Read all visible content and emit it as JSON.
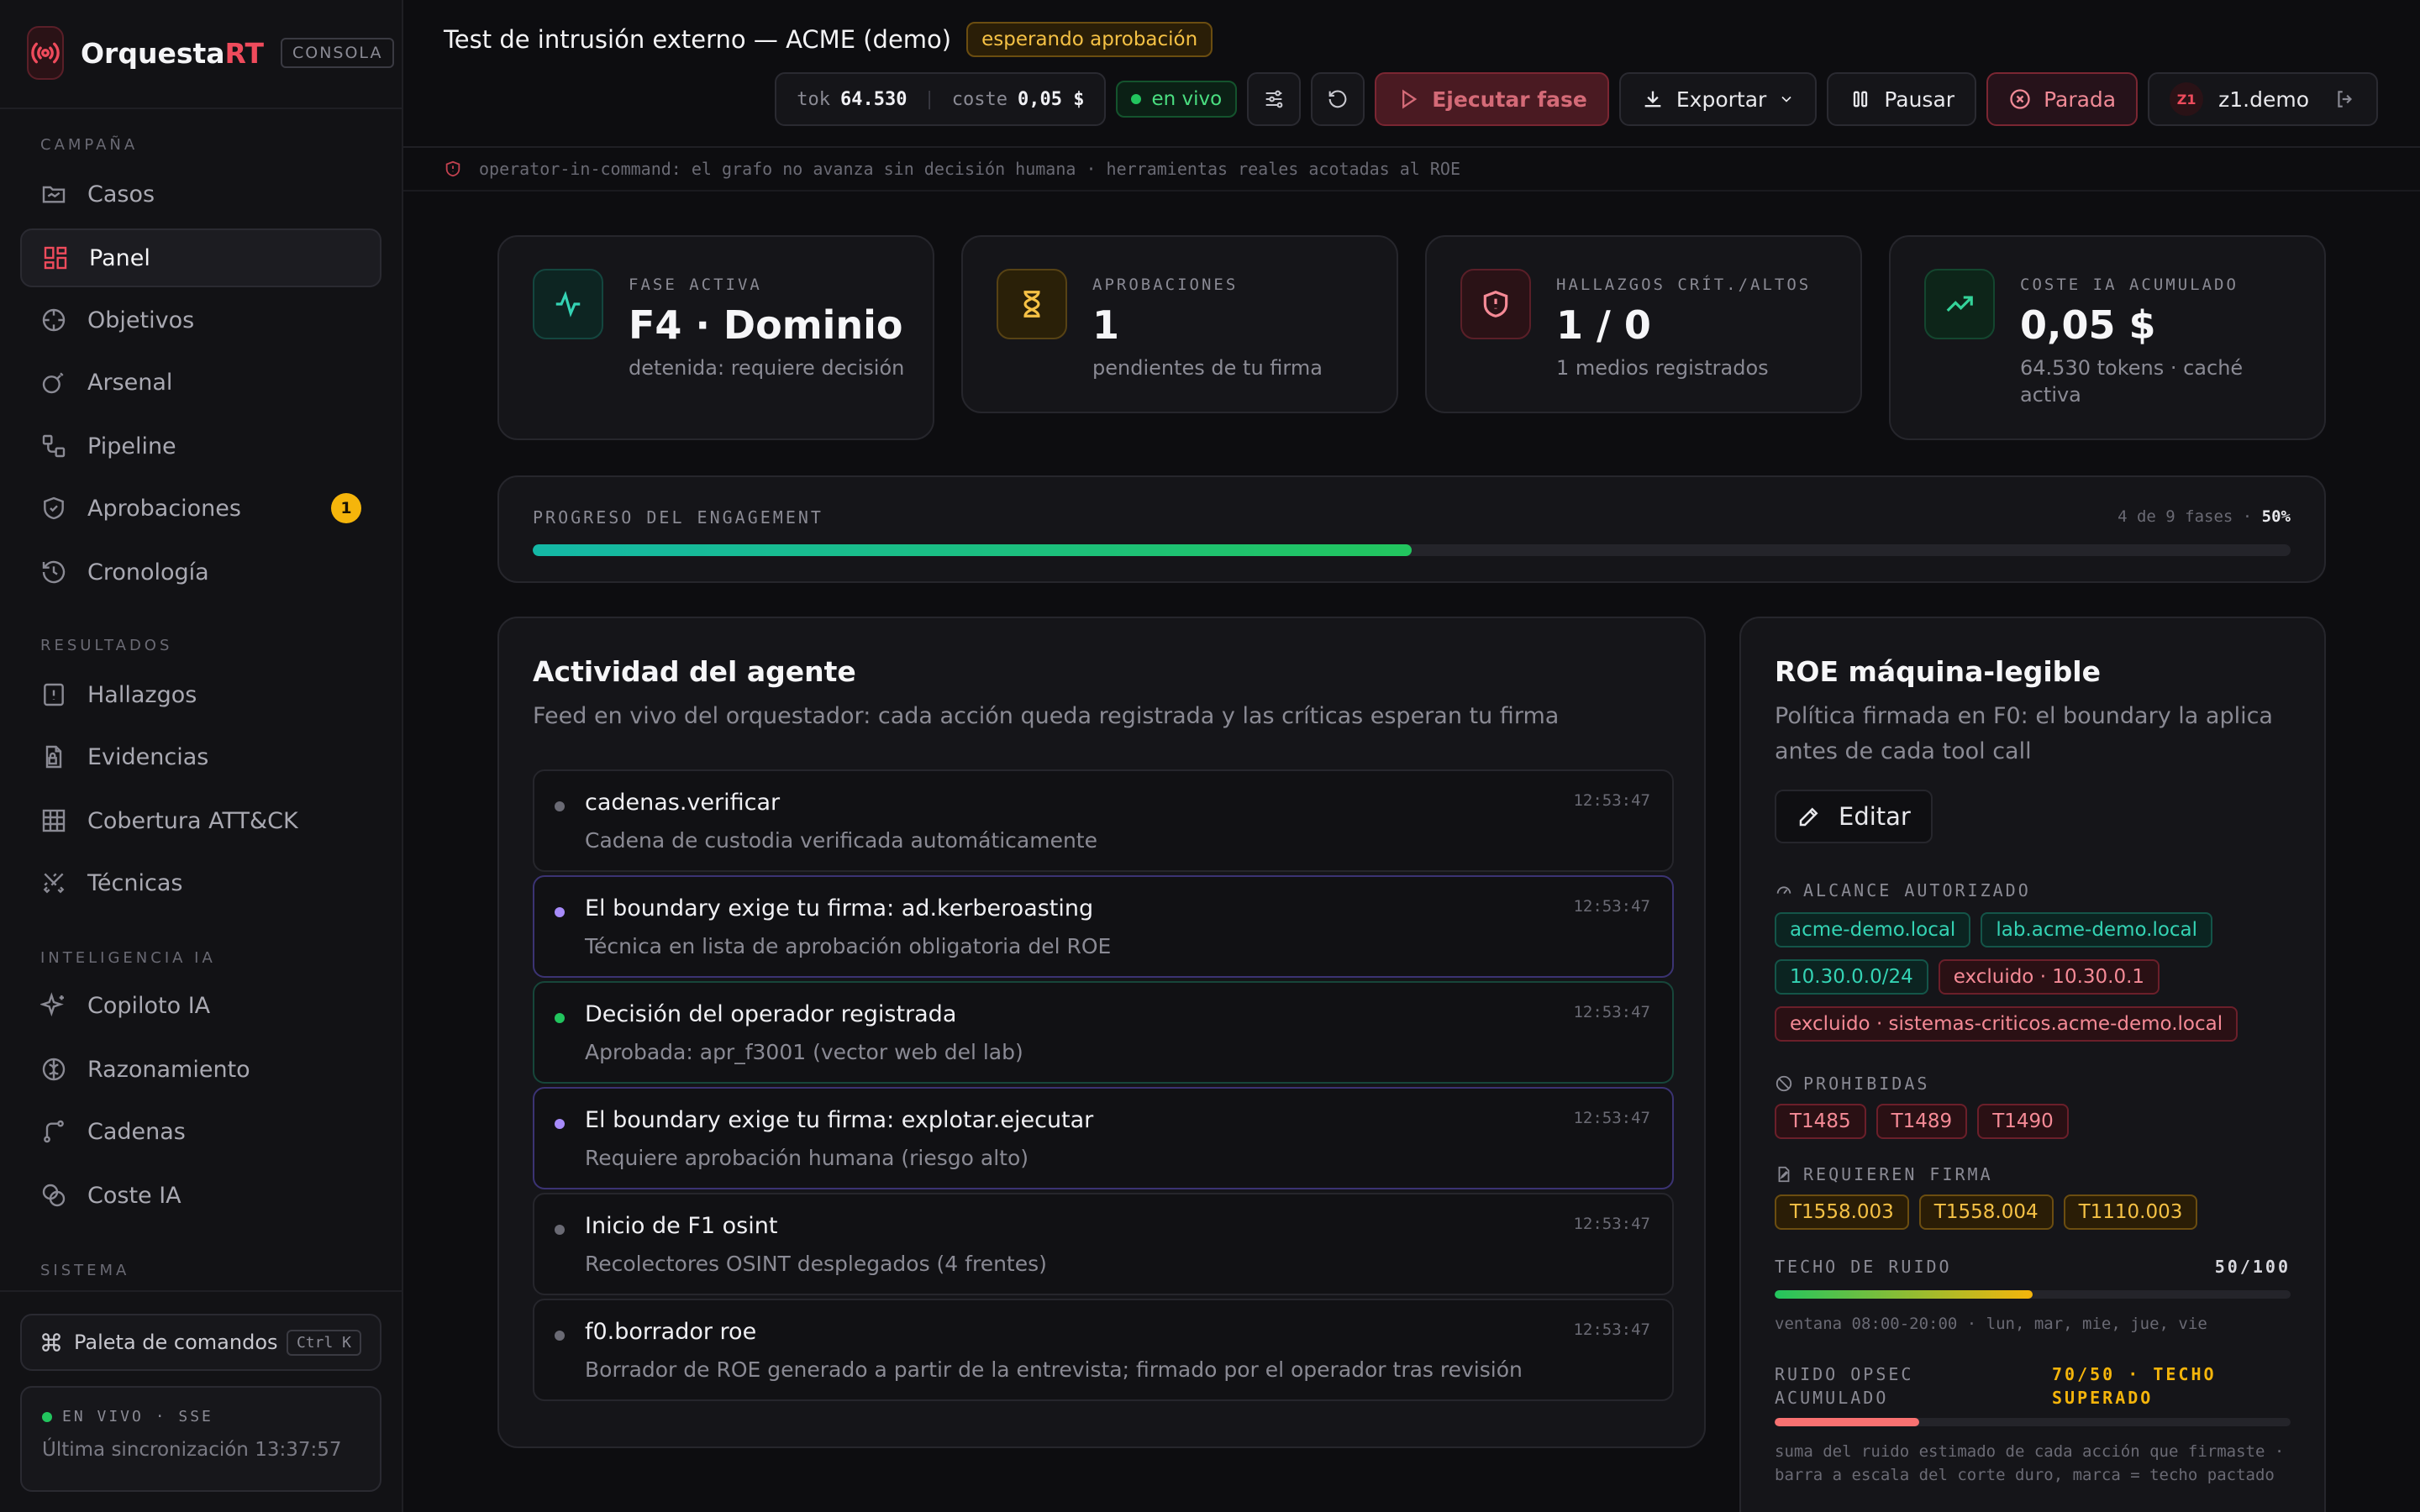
{
  "brand": {
    "name_main": "Orquesta",
    "name_accent": "RT",
    "tag": "CONSOLA"
  },
  "sidebar": {
    "sections": {
      "campaign": "CAMPAÑA",
      "results": "RESULTADOS",
      "ai": "INTELIGENCIA IA",
      "system": "SISTEMA"
    },
    "items": [
      {
        "label": "Casos",
        "icon": "folder-icon"
      },
      {
        "label": "Panel",
        "icon": "dashboard-icon",
        "active": true
      },
      {
        "label": "Objetivos",
        "icon": "crosshair-icon"
      },
      {
        "label": "Arsenal",
        "icon": "bomb-icon"
      },
      {
        "label": "Pipeline",
        "icon": "workflow-icon"
      },
      {
        "label": "Aprobaciones",
        "icon": "shield-check-icon",
        "badge": "1"
      },
      {
        "label": "Cronología",
        "icon": "history-icon"
      },
      {
        "label": "Hallazgos",
        "icon": "file-alert-icon"
      },
      {
        "label": "Evidencias",
        "icon": "file-lock-icon"
      },
      {
        "label": "Cobertura ATT&CK",
        "icon": "grid-icon"
      },
      {
        "label": "Técnicas",
        "icon": "swords-icon"
      },
      {
        "label": "Copiloto IA",
        "icon": "sparkles-icon"
      },
      {
        "label": "Razonamiento",
        "icon": "brain-icon"
      },
      {
        "label": "Cadenas",
        "icon": "route-icon"
      },
      {
        "label": "Coste IA",
        "icon": "coins-icon"
      }
    ],
    "command_palette": {
      "label": "Paleta de comandos",
      "shortcut": "Ctrl K"
    },
    "live": {
      "label": "EN VIVO · SSE",
      "sync": "Última sincronización 13:37:57"
    }
  },
  "header": {
    "title": "Test de intrusión externo — ACME (demo)",
    "status": "esperando aprobación",
    "tok_label": "tok",
    "tok_value": "64.530",
    "cost_label": "coste",
    "cost_value": "0,05 $",
    "live_label": "en vivo",
    "run_label": "Ejecutar fase",
    "export_label": "Exportar",
    "pause_label": "Pausar",
    "stop_label": "Parada",
    "user_initials": "Z1",
    "user_name": "z1.demo"
  },
  "operator_bar": "operator-in-command: el grafo no avanza sin decisión humana · herramientas reales acotadas al ROE",
  "stats": [
    {
      "label": "FASE ACTIVA",
      "value": "F4 · Dominio",
      "sub": "detenida: requiere decisión",
      "icon": "activity-icon",
      "accent": "#34d3b4"
    },
    {
      "label": "APROBACIONES",
      "value": "1",
      "sub": "pendientes de tu firma",
      "icon": "hourglass-icon",
      "accent": "#f5c145"
    },
    {
      "label": "HALLAZGOS CRÍT./ALTOS",
      "value": "1 / 0",
      "sub": "1 medios registrados",
      "icon": "shield-alert-icon",
      "accent": "#f58a96"
    },
    {
      "label": "COSTE IA ACUMULADO",
      "value": "0,05 $",
      "sub": "64.530 tokens · caché activa",
      "icon": "trending-up-icon",
      "accent": "#34d399"
    }
  ],
  "progress": {
    "label": "PROGRESO DEL ENGAGEMENT",
    "phases_text": "4 de 9 fases",
    "percent_text": "50%",
    "fraction": 0.5
  },
  "activity": {
    "title": "Actividad del agente",
    "subtitle": "Feed en vivo del orquestador: cada acción queda registrada y las críticas esperan tu firma",
    "items": [
      {
        "title": "cadenas.verificar",
        "desc": "Cadena de custodia verificada automáticamente",
        "time": "12:53:47",
        "kind": "neutral"
      },
      {
        "title": "El boundary exige tu firma: ad.kerberoasting",
        "desc": "Técnica en lista de aprobación obligatoria del ROE",
        "time": "12:53:47",
        "kind": "purple"
      },
      {
        "title": "Decisión del operador registrada",
        "desc": "Aprobada: apr_f3001 (vector web del lab)",
        "time": "12:53:47",
        "kind": "green"
      },
      {
        "title": "El boundary exige tu firma: explotar.ejecutar",
        "desc": "Requiere aprobación humana (riesgo alto)",
        "time": "12:53:47",
        "kind": "purple"
      },
      {
        "title": "Inicio de F1 osint",
        "desc": "Recolectores OSINT desplegados (4 frentes)",
        "time": "12:53:47",
        "kind": "neutral"
      },
      {
        "title": "f0.borrador roe",
        "desc": "Borrador de ROE generado a partir de la entrevista; firmado por el operador tras revisión",
        "time": "12:53:47",
        "kind": "neutral"
      }
    ]
  },
  "roe": {
    "title": "ROE máquina-legible",
    "subtitle": "Política firmada en F0: el boundary la aplica antes de cada tool call",
    "edit_label": "Editar",
    "scope_label": "ALCANCE AUTORIZADO",
    "scope": [
      {
        "text": "acme-demo.local",
        "kind": "teal"
      },
      {
        "text": "lab.acme-demo.local",
        "kind": "teal"
      },
      {
        "text": "10.30.0.0/24",
        "kind": "teal"
      },
      {
        "text": "excluido · 10.30.0.1",
        "kind": "red"
      },
      {
        "text": "excluido · sistemas-criticos.acme-demo.local",
        "kind": "red"
      }
    ],
    "forbidden_label": "PROHIBIDAS",
    "forbidden": [
      "T1485",
      "T1489",
      "T1490"
    ],
    "signature_label": "REQUIEREN FIRMA",
    "signature": [
      "T1558.003",
      "T1558.004",
      "T1110.003"
    ],
    "noise_ceiling_label": "TECHO DE RUIDO",
    "noise_ceiling_value": "50/100",
    "noise_ceiling_fraction": 0.5,
    "noise_window": "ventana 08:00-20:00 · lun, mar, mie, jue, vie",
    "opsec_label": "RUIDO OPSEC ACUMULADO",
    "opsec_value": "70/50 · TECHO SUPERADO",
    "opsec_fraction": 0.28,
    "opsec_note": "suma del ruido estimado de cada acción que firmaste · barra a escala del corte duro, marca = techo pactado"
  }
}
